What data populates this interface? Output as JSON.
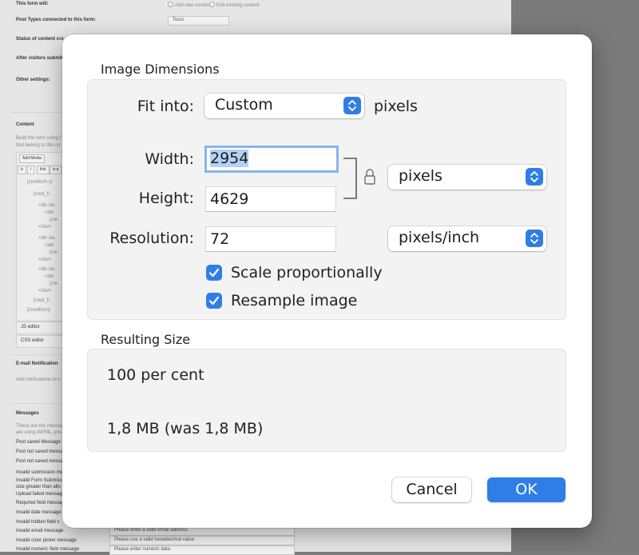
{
  "background": {
    "rows": [
      {
        "label": "This form will:",
        "radio1": "Add new content",
        "radio2": "Edit existing content"
      },
      {
        "label": "Post Types connected to this form:",
        "select": "Tours"
      },
      {
        "label": "Status of content cre"
      },
      {
        "label": "After visitors submit"
      },
      {
        "label": "Other settings:"
      }
    ],
    "content_heading": "Content",
    "content_desc_1": "Build the form using f",
    "content_desc_2": "that belong to this co",
    "add_media": "Add Media",
    "toolbar_buttons": [
      "b",
      "i",
      "link",
      "b-q"
    ],
    "code_lines": [
      "[credform cl",
      "[cred_fi",
      "<div cla",
      "<lab",
      "[cre",
      "</div>",
      "<div cla",
      "<lab",
      "[cre",
      "</div>",
      "<div cla",
      "<lab",
      "[cre",
      "</div>",
      "[cred_fi",
      "[/credform]"
    ],
    "js_editor": "JS editor",
    "css_editor": "CSS editor",
    "email_heading": "E-mail Notification",
    "email_desc": "Add notifications to n",
    "messages_heading": "Messages",
    "messages_desc_1": "These are the messag",
    "messages_desc_2": "are using WPML, you",
    "message_rows": [
      {
        "label": "Post saved Message"
      },
      {
        "label": "Post not saved messa"
      },
      {
        "label": "Post not saved messa"
      },
      {
        "label": "Invalid submission me"
      },
      {
        "label": "Invalid Form Submissi"
      },
      {
        "label": "size greater than allo"
      },
      {
        "label": "Upload failed messag"
      },
      {
        "label": "Required field messag"
      },
      {
        "label": "Invalid date message"
      },
      {
        "label": "Invalid hidden field v"
      },
      {
        "label": "Invalid email message",
        "value": "Please enter a valid email address"
      },
      {
        "label": "Invalid color picker message",
        "value": "Please use a valid hexadecimal value"
      },
      {
        "label": "Invalid numeric field message",
        "value": "Please enter numeric data"
      }
    ]
  },
  "dialog": {
    "image_dimensions_title": "Image Dimensions",
    "fit_into_label": "Fit into:",
    "fit_into_value": "Custom",
    "fit_into_suffix": "pixels",
    "width_label": "Width:",
    "width_value": "2954",
    "height_label": "Height:",
    "height_value": "4629",
    "size_unit": "pixels",
    "resolution_label": "Resolution:",
    "resolution_value": "72",
    "resolution_unit": "pixels/inch",
    "scale_label": "Scale proportionally",
    "scale_checked": true,
    "resample_label": "Resample image",
    "resample_checked": true,
    "resulting_size_title": "Resulting Size",
    "percent_text": "100 per cent",
    "size_text": "1,8 MB (was 1,8 MB)",
    "cancel_label": "Cancel",
    "ok_label": "OK"
  },
  "colors": {
    "accent": "#2f7ee6",
    "selection": "#b3d2f8",
    "focus_ring": "#89b4ee",
    "group_bg": "#f3f3f3"
  }
}
